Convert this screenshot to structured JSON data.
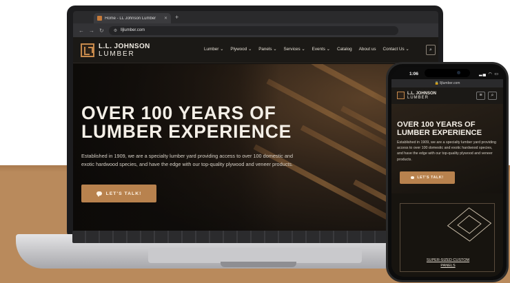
{
  "browser": {
    "tab_title": "Home - LL Johnson Lumber",
    "tab_close": "✕",
    "new_tab": "+",
    "back": "←",
    "forward": "→",
    "reload": "↻",
    "url": "lljlumber.com"
  },
  "site": {
    "logo_line1": "L.L. JOHNSON",
    "logo_line2": "LUMBER",
    "nav": [
      "Lumber ⌄",
      "Plywood ⌄",
      "Panels ⌄",
      "Services ⌄",
      "Events ⌄",
      "Catalog",
      "About us",
      "Contact Us ⌄"
    ],
    "hero_title_line1": "OVER 100 YEARS OF",
    "hero_title_line2": "LUMBER EXPERIENCE",
    "hero_body": "Established in 1909, we are a specialty lumber yard providing access to over 100 domestic and exotic hardwood species, and have the edge with our top-quality plywood and veneer products.",
    "cta_label": "LET'S TALK!"
  },
  "phone": {
    "time": "1:06",
    "status_icons": "▂▄ ◠ ▭",
    "url": "🔒 lljlumber.com",
    "hero_title_line1": "OVER 100 YEARS OF",
    "hero_title_line2": "LUMBER EXPERIENCE",
    "hero_body": "Established in 1909, we are a specialty lumber yard providing access to over 100 domestic and exotic hardwood species, and have the edge with our top-quality plywood and veneer products.",
    "cta_label": "LET'S TALK!",
    "card_label_line1": "SUPER-SIZED CUSTOM",
    "card_label_line2": "PANELS"
  },
  "colors": {
    "accent": "#b8824e",
    "header_bg": "#1b1916",
    "desk": "#b98a5c"
  }
}
